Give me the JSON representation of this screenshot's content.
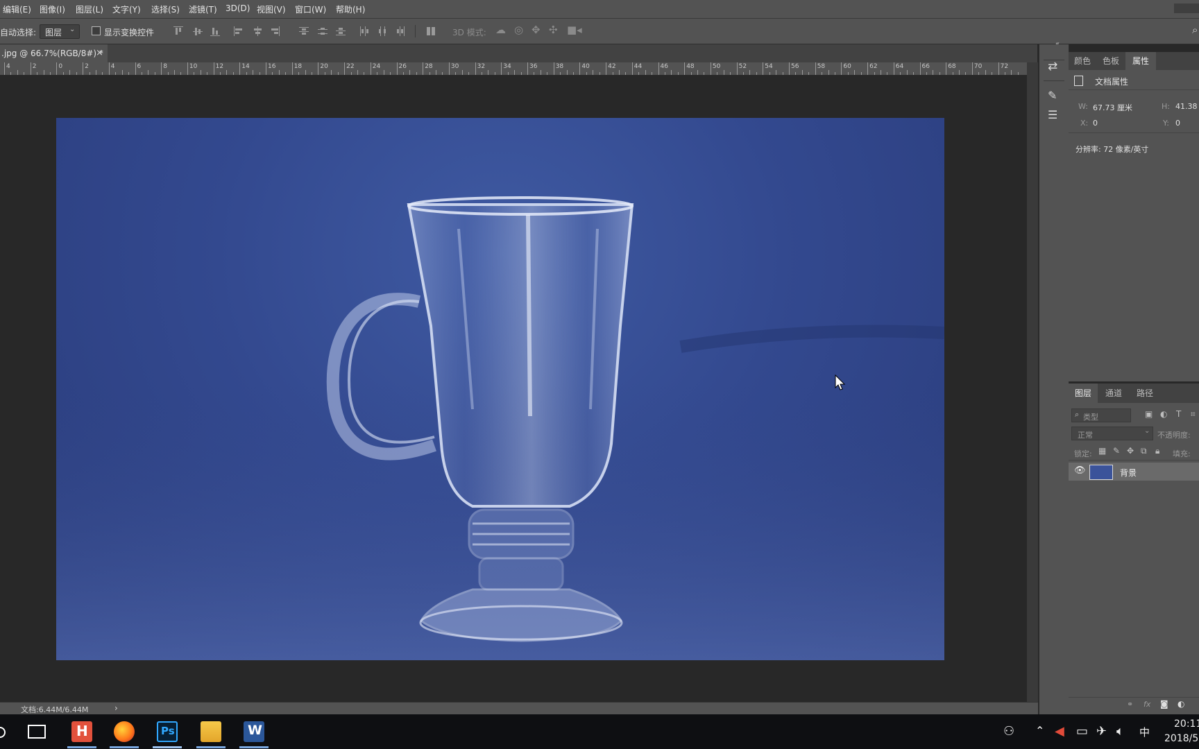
{
  "menu": [
    "编辑(E)",
    "图像(I)",
    "图层(L)",
    "文字(Y)",
    "选择(S)",
    "滤镜(T)",
    "3D(D)",
    "视图(V)",
    "窗口(W)",
    "帮助(H)"
  ],
  "options": {
    "auto_select_label": "自动选择:",
    "auto_select_value": "图层",
    "show_transform_label": "显示变换控件",
    "mode_3d_label": "3D 模式:"
  },
  "document_tab": {
    "title": ".jpg @ 66.7%(RGB/8#) *",
    "close": "×"
  },
  "ruler_labels": [
    "4",
    "2",
    "0",
    "2",
    "4",
    "6",
    "8",
    "10",
    "12",
    "14",
    "16",
    "18",
    "20",
    "22",
    "24",
    "26",
    "28",
    "30",
    "32",
    "34",
    "36",
    "38",
    "40",
    "42",
    "44",
    "46",
    "48",
    "50",
    "52",
    "54",
    "56",
    "58",
    "60",
    "62",
    "64",
    "66",
    "68",
    "70",
    "72"
  ],
  "status": {
    "doc_size": "文档:6.44M/6.44M",
    "arrow": "›"
  },
  "properties_panel": {
    "tabs": [
      "颜色",
      "色板",
      "属性"
    ],
    "active_tab": "属性",
    "header": "文档属性",
    "w_label": "W:",
    "w_value": "67.73 厘米",
    "h_label": "H:",
    "h_value": "41.38",
    "x_label": "X:",
    "x_value": "0",
    "y_label": "Y:",
    "y_value": "0",
    "resolution": "分辨率: 72 像素/英寸"
  },
  "layers_panel": {
    "tabs": [
      "图层",
      "通道",
      "路径"
    ],
    "active_tab": "图层",
    "filter_placeholder": "类型",
    "blend_mode": "正常",
    "opacity_label": "不透明度:",
    "lock_label": "锁定:",
    "fill_label": "填充:",
    "layers": [
      {
        "name": "背景",
        "visible": true
      }
    ]
  },
  "taskbar": {
    "apps": [
      "task-view",
      "h-app",
      "firefox",
      "photoshop",
      "file-explorer",
      "word"
    ],
    "ps_label": "Ps",
    "word_label": "W",
    "h_label": "H",
    "ime": "中",
    "time": "20:11",
    "date": "2018/5"
  },
  "colors": {
    "chrome": "#535353",
    "canvas_bg": "#282828",
    "backdrop_blue": "#33498f",
    "taskbar": "#0e0f12"
  }
}
